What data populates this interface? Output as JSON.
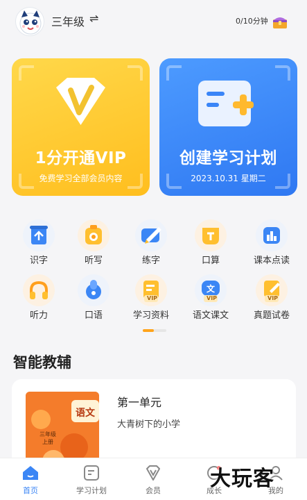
{
  "header": {
    "grade": "三年级",
    "switch_icon": "⇌",
    "timer": "0/10分钟",
    "avatar_icon": "mascot-avatar-icon",
    "chest_icon": "treasure-chest-icon"
  },
  "banners": {
    "vip": {
      "title": "1分开通VIP",
      "subtitle": "免费学习全部会员内容",
      "color": "#ffc629"
    },
    "plan": {
      "title": "创建学习计划",
      "subtitle": "2023.10.31 星期二",
      "color": "#3a85f7"
    }
  },
  "features": [
    {
      "label": "识字",
      "icon": "scroll-icon"
    },
    {
      "label": "听写",
      "icon": "dictation-icon"
    },
    {
      "label": "练字",
      "icon": "pen-icon"
    },
    {
      "label": "口算",
      "icon": "calculator-icon"
    },
    {
      "label": "课本点读",
      "icon": "chart-book-icon"
    },
    {
      "label": "听力",
      "icon": "headphones-icon"
    },
    {
      "label": "口语",
      "icon": "microphone-icon"
    },
    {
      "label": "学习资料",
      "icon": "vip-document-icon",
      "badge": "VIP"
    },
    {
      "label": "语文课文",
      "icon": "vip-chinese-icon",
      "badge": "VIP",
      "icon_text": "文"
    },
    {
      "label": "真题试卷",
      "icon": "vip-exam-icon",
      "badge": "VIP"
    }
  ],
  "section": {
    "title": "智能教辅"
  },
  "lesson": {
    "unit": "第一单元",
    "name": "大青树下的小学",
    "book_subject": "语文",
    "book_grade_line1": "三年级",
    "book_grade_line2": "上册"
  },
  "tabs": [
    {
      "label": "首页",
      "icon": "home-icon",
      "active": true
    },
    {
      "label": "学习计划",
      "icon": "plan-icon",
      "active": false
    },
    {
      "label": "会员",
      "icon": "vip-icon",
      "active": false
    },
    {
      "label": "成长",
      "icon": "growth-icon",
      "active": false
    },
    {
      "label": "我的",
      "icon": "profile-icon",
      "active": false
    }
  ],
  "watermark": "大玩客",
  "colors": {
    "accent": "#3b86f5",
    "orange": "#ffa41c"
  }
}
